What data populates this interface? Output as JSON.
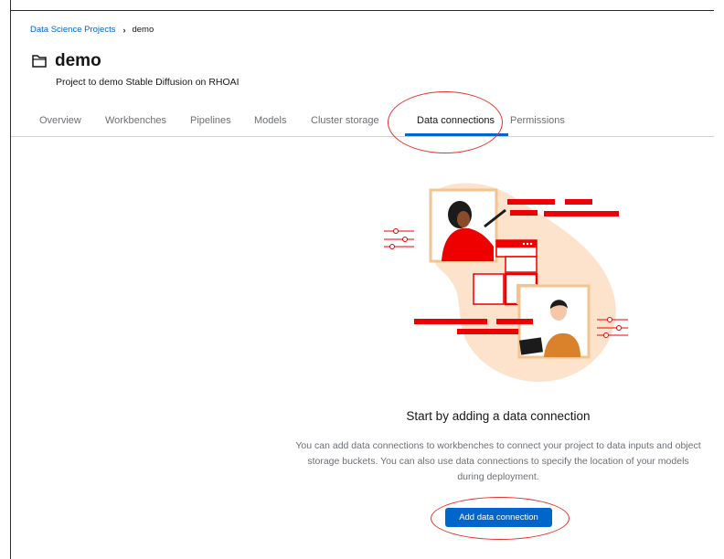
{
  "breadcrumb": {
    "parent": "Data Science Projects",
    "current": "demo"
  },
  "project": {
    "title": "demo",
    "description": "Project to demo Stable Diffusion on RHOAI",
    "icon": "project-folder-icon"
  },
  "tabs": [
    {
      "label": "Overview",
      "active": false
    },
    {
      "label": "Workbenches",
      "active": false
    },
    {
      "label": "Pipelines",
      "active": false
    },
    {
      "label": "Models",
      "active": false
    },
    {
      "label": "Cluster storage",
      "active": false
    },
    {
      "label": "Data connections",
      "active": true
    },
    {
      "label": "Permissions",
      "active": false
    }
  ],
  "empty_state": {
    "title": "Start by adding a data connection",
    "body": "You can add data connections to workbenches to connect your project to data inputs and object storage buckets. You can also use data connections to specify the location of your models during deployment.",
    "button_label": "Add data connection"
  },
  "colors": {
    "accent": "#0066cc",
    "highlight_oval": "#e4312b",
    "illustration_red": "#ee0000",
    "illustration_peach": "#fde3cc"
  }
}
